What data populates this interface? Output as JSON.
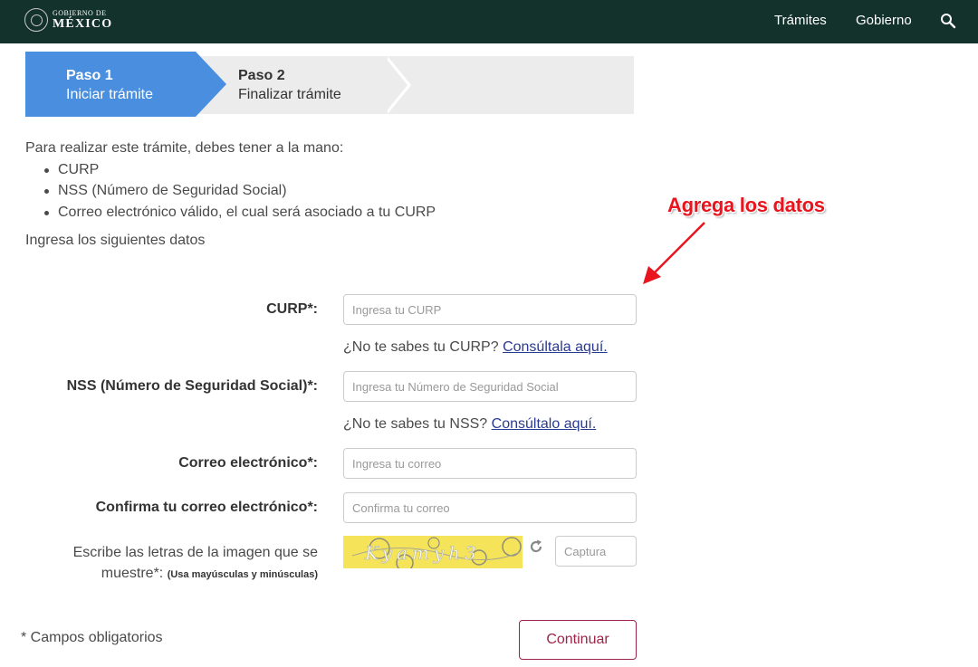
{
  "header": {
    "logo_line1": "GOBIERNO DE",
    "logo_line2": "MÉXICO",
    "nav": [
      "Trámites",
      "Gobierno"
    ],
    "search_icon": "search-icon",
    "bg_color": "#13322b"
  },
  "stepper": {
    "steps": [
      {
        "number": "Paso 1",
        "label": "Iniciar trámite",
        "active": true
      },
      {
        "number": "Paso 2",
        "label": "Finalizar trámite",
        "active": false
      }
    ],
    "active_color": "#4a8fdf",
    "inactive_color": "#ececec"
  },
  "intro": {
    "text": "Para realizar este trámite, debes tener a la mano:",
    "items": [
      "CURP",
      "NSS (Número de Seguridad Social)",
      "Correo electrónico válido, el cual será asociado a tu CURP"
    ],
    "datos_heading": "Ingresa los siguientes datos"
  },
  "annotation": {
    "text": "Agrega los datos",
    "color": "#e8141e"
  },
  "form": {
    "curp": {
      "label": "CURP*:",
      "placeholder": "Ingresa tu CURP",
      "help_text": "¿No te sabes tu CURP? ",
      "help_link": "Consúltala aquí."
    },
    "nss": {
      "label": "NSS (Número de Seguridad Social)*:",
      "placeholder": "Ingresa tu Número de Seguridad Social",
      "help_text": "¿No te sabes tu NSS? ",
      "help_link": "Consúltalo aquí."
    },
    "email": {
      "label": "Correo electrónico*:",
      "placeholder": "Ingresa tu correo"
    },
    "email_confirm": {
      "label": "Confirma tu correo electrónico*:",
      "placeholder": "Confirma tu correo"
    },
    "captcha": {
      "label": "Escribe las letras de la imagen que se muestre*: ",
      "note": "(Usa mayúsculas y minúsculas)",
      "placeholder": "Captura",
      "image_text": "Kyamyh3"
    },
    "required_note": "* Campos obligatorios",
    "submit_label": "Continuar",
    "submit_color": "#9d2449"
  }
}
